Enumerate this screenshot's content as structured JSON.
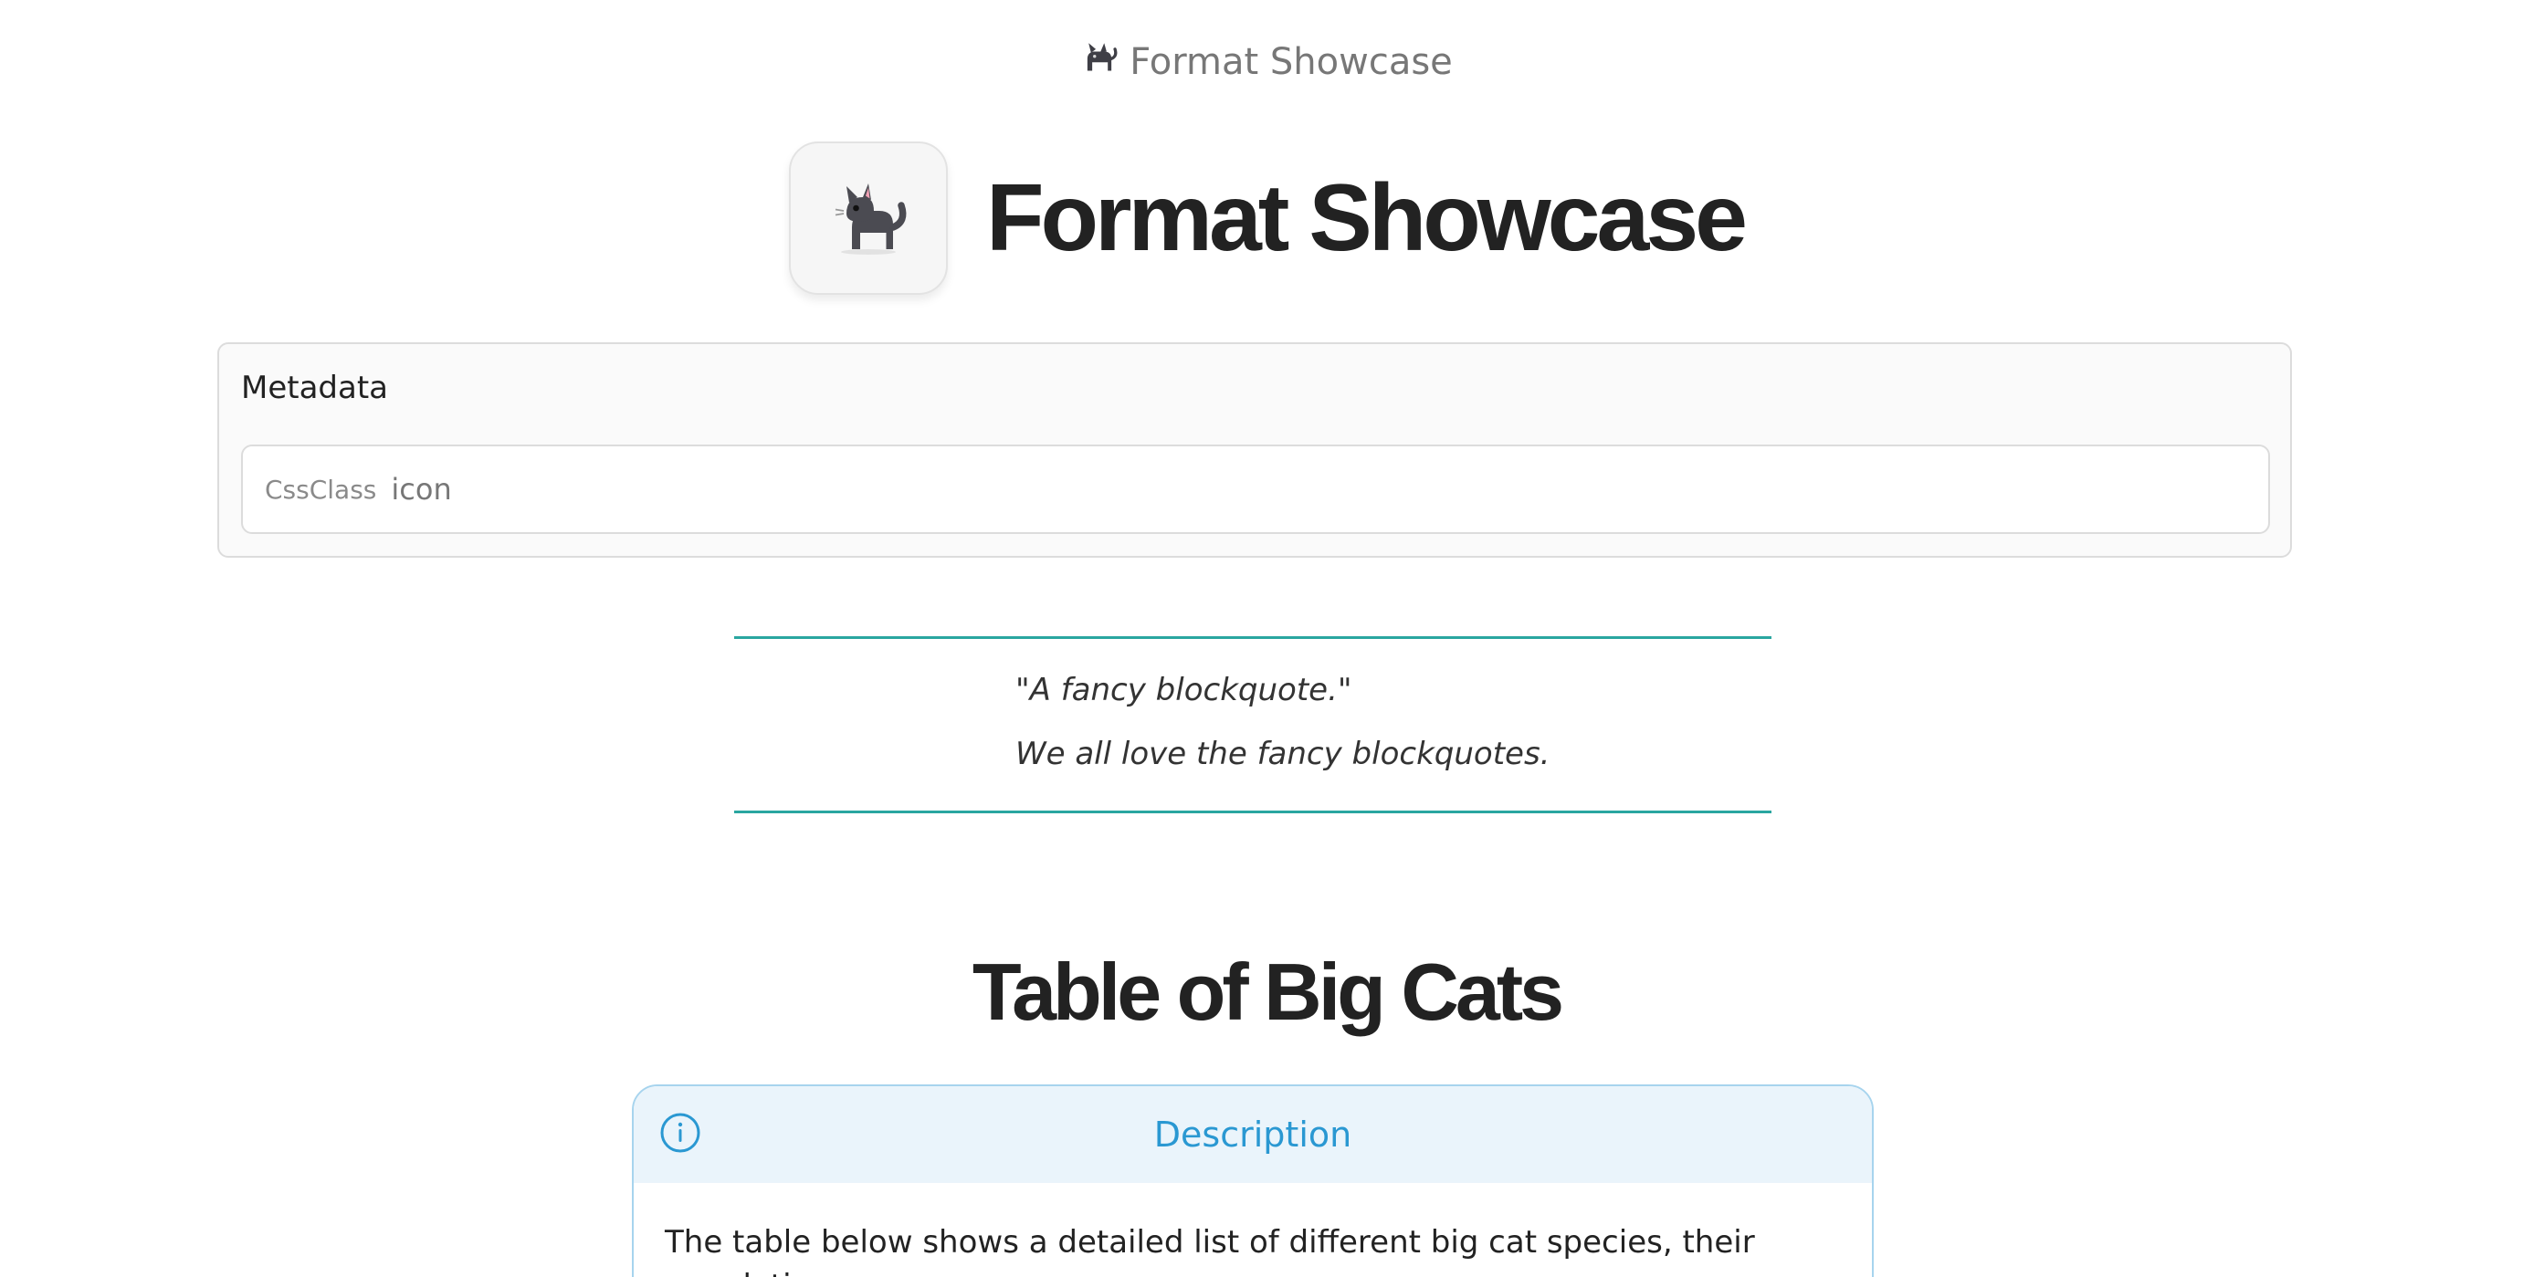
{
  "page": {
    "top_title": "Format Showcase",
    "top_icon": "cat-emoji-icon"
  },
  "header": {
    "icon": "cat-emoji-icon",
    "title": "Format Showcase"
  },
  "metadata": {
    "title": "Metadata",
    "fields": [
      {
        "key": "CssClass",
        "value": "icon"
      }
    ]
  },
  "blockquote": {
    "line1": "\"A fancy blockquote.\"",
    "line2": "We all love the fancy blockquotes."
  },
  "section": {
    "title": "Table of Big Cats"
  },
  "callout": {
    "icon": "info-icon",
    "title": "Description",
    "body": "The table below shows a detailed list of different big cat species, their populations,"
  },
  "colors": {
    "accent_teal": "#2aa6a0",
    "callout_blue": "#2a98d2",
    "callout_bg": "#eaf4fb",
    "callout_border": "#a7d4ee"
  }
}
